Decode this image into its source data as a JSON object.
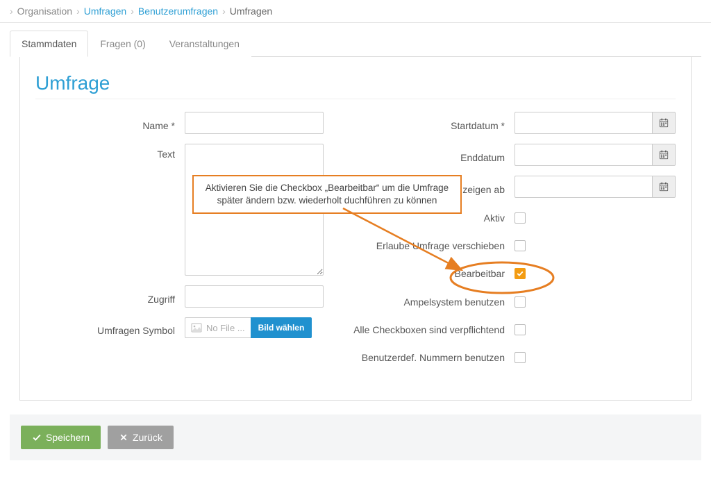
{
  "breadcrumb": {
    "items": [
      {
        "label": "Organisation",
        "link": false
      },
      {
        "label": "Umfragen",
        "link": true
      },
      {
        "label": "Benutzerumfragen",
        "link": true
      },
      {
        "label": "Umfragen",
        "link": false,
        "current": true
      }
    ]
  },
  "tabs": [
    {
      "label": "Stammdaten",
      "active": true
    },
    {
      "label": "Fragen (0)",
      "active": false
    },
    {
      "label": "Veranstaltungen",
      "active": false
    }
  ],
  "page": {
    "title": "Umfrage"
  },
  "form": {
    "left": {
      "name": {
        "label": "Name *",
        "value": ""
      },
      "text": {
        "label": "Text",
        "value": ""
      },
      "zugriff": {
        "label": "Zugriff",
        "value": ""
      },
      "symbol": {
        "label": "Umfragen Symbol",
        "file_placeholder": "No File ...",
        "choose_label": "Bild wählen"
      }
    },
    "right": {
      "startdatum": {
        "label": "Startdatum *",
        "value": ""
      },
      "enddatum": {
        "label": "Enddatum",
        "value": ""
      },
      "ergebnisse": {
        "label": "Ergebnisse zeigen ab",
        "value": ""
      },
      "aktiv": {
        "label": "Aktiv",
        "checked": false
      },
      "verschieben": {
        "label": "Erlaube Umfrage verschieben",
        "checked": false
      },
      "bearbeitbar": {
        "label": "Bearbeitbar",
        "checked": true
      },
      "ampel": {
        "label": "Ampelsystem benutzen",
        "checked": false
      },
      "verpflichtend": {
        "label": "Alle Checkboxen sind verpflichtend",
        "checked": false
      },
      "nummern": {
        "label": "Benutzerdef. Nummern benutzen",
        "checked": false
      }
    }
  },
  "annotation": {
    "text": "Aktivieren Sie die Checkbox „Bearbeitbar“ um die Umfrage später ändern bzw. wiederholt duchführen zu können"
  },
  "footer": {
    "save": "Speichern",
    "back": "Zurück"
  }
}
